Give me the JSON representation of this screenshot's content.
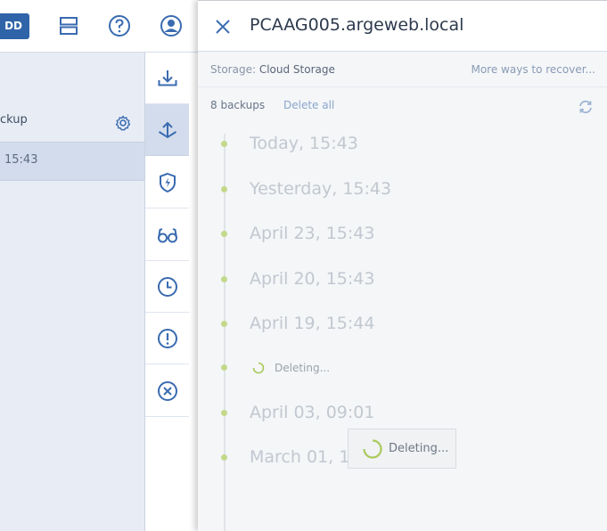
{
  "topbar": {
    "add_label": "DD"
  },
  "plan": {
    "name": "ckup",
    "selected_time": "15:43"
  },
  "panel": {
    "title": "PCAAG005.argeweb.local",
    "storage_label": "Storage:",
    "storage_value": "Cloud Storage",
    "more_ways": "More ways to recover...",
    "backup_count": "8 backups",
    "delete_all": "Delete all"
  },
  "backups": [
    {
      "label": "Today, 15:43",
      "state": "normal"
    },
    {
      "label": "Yesterday, 15:43",
      "state": "normal"
    },
    {
      "label": "April 23, 15:43",
      "state": "normal"
    },
    {
      "label": "April 20, 15:43",
      "state": "normal"
    },
    {
      "label": "April 19, 15:44",
      "state": "normal"
    },
    {
      "label": "Deleting...",
      "state": "deleting"
    },
    {
      "label": "April 03, 09:01",
      "state": "normal"
    },
    {
      "label": "March 01, 15:43",
      "state": "normal"
    }
  ],
  "overlay": {
    "text": "Deleting..."
  },
  "colors": {
    "accent": "#2f64a8",
    "icon": "#3a6bb0",
    "timeline_dot": "#c3d98a",
    "spinner": "#a9c95a"
  }
}
